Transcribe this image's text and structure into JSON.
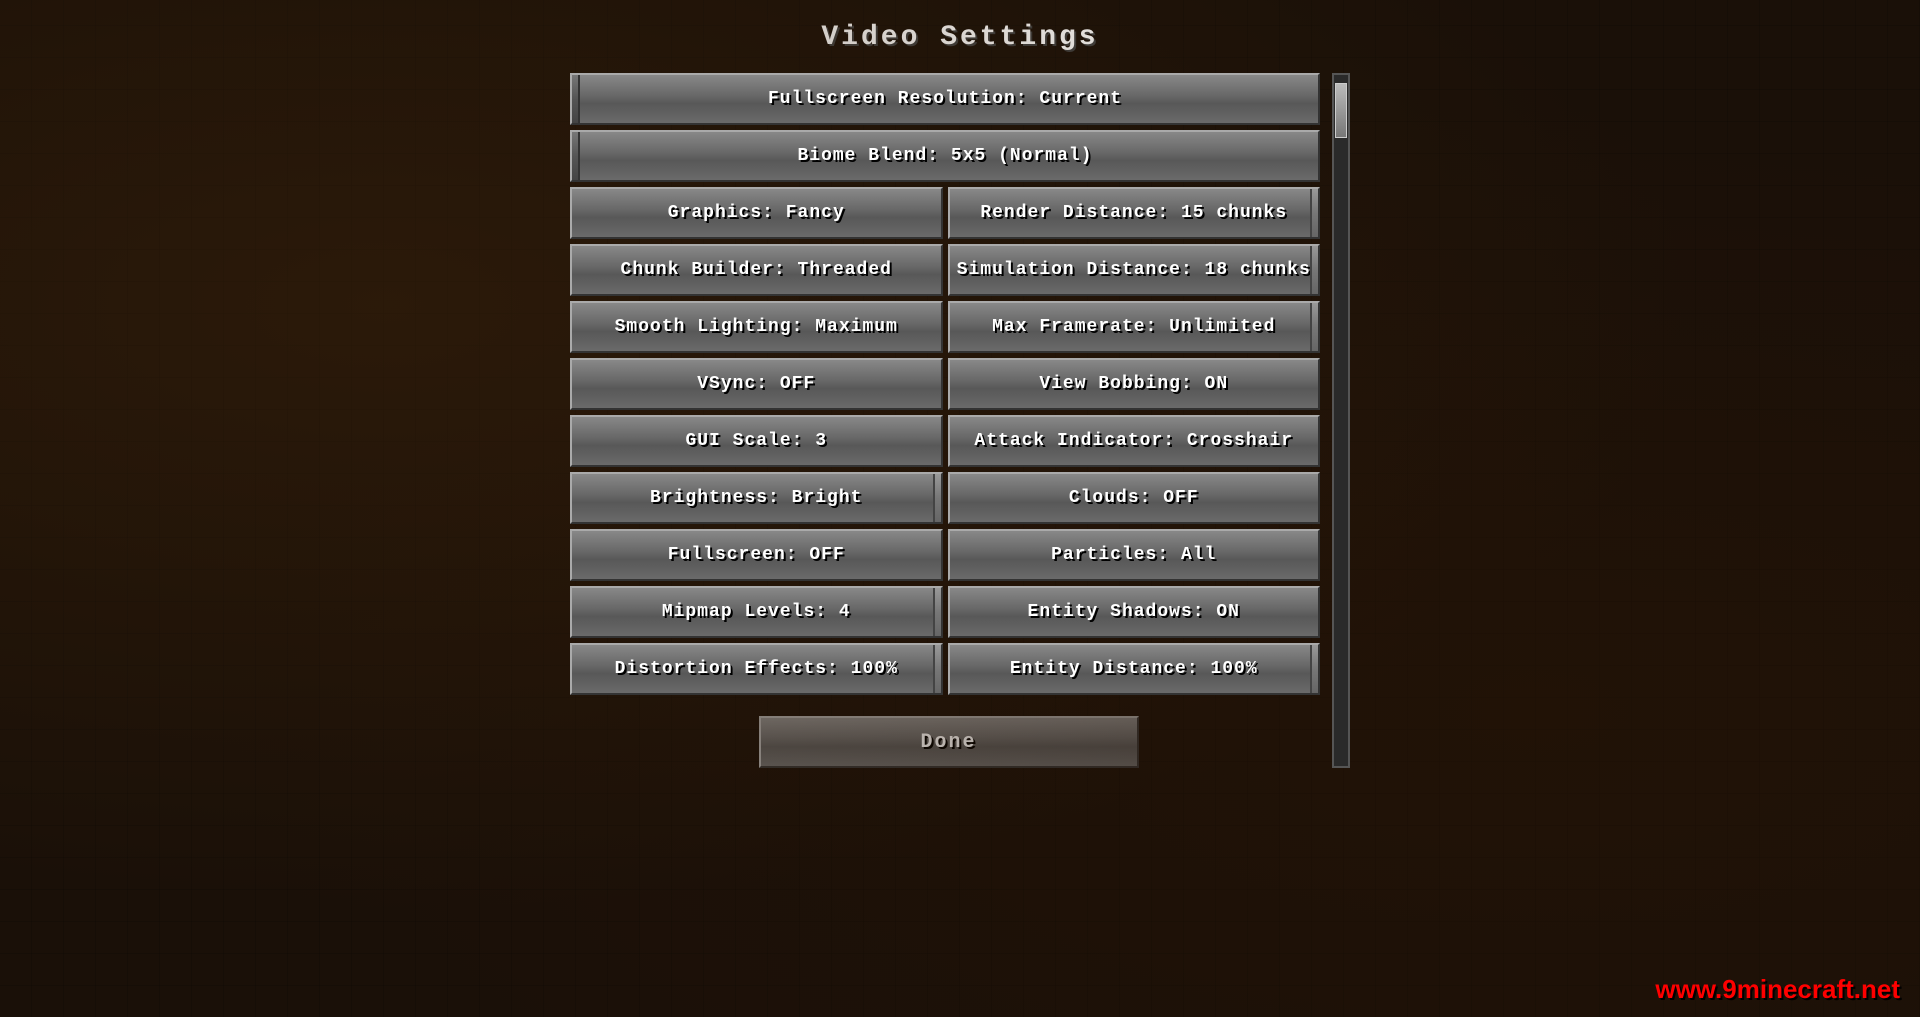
{
  "page": {
    "title": "Video Settings"
  },
  "settings": {
    "fullscreen_resolution": "Fullscreen Resolution: Current",
    "biome_blend": "Biome Blend: 5x5 (Normal)",
    "graphics": "Graphics: Fancy",
    "render_distance": "Render Distance: 15 chunks",
    "chunk_builder": "Chunk Builder: Threaded",
    "simulation_distance": "Simulation Distance: 18 chunks",
    "smooth_lighting": "Smooth Lighting: Maximum",
    "max_framerate": "Max Framerate: Unlimited",
    "vsync": "VSync: OFF",
    "view_bobbing": "View Bobbing: ON",
    "gui_scale": "GUI Scale: 3",
    "attack_indicator": "Attack Indicator: Crosshair",
    "brightness": "Brightness: Bright",
    "clouds": "Clouds: OFF",
    "fullscreen": "Fullscreen: OFF",
    "particles": "Particles: All",
    "mipmap_levels": "Mipmap Levels: 4",
    "entity_shadows": "Entity Shadows: ON",
    "distortion_effects": "Distortion Effects: 100%",
    "entity_distance": "Entity Distance: 100%",
    "done": "Done"
  },
  "watermark": {
    "text": "www.9minecraft.net"
  }
}
